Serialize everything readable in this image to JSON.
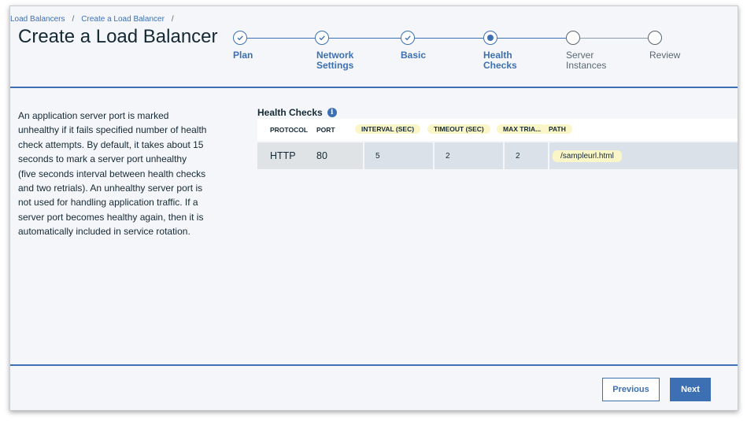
{
  "breadcrumb": {
    "item1": "Load Balancers",
    "item2": "Create a Load Balancer",
    "sep": "/"
  },
  "page_title": "Create a Load Balancer",
  "stepper": {
    "steps": [
      {
        "label": "Plan",
        "state": "complete"
      },
      {
        "label": "Network\nSettings",
        "state": "complete"
      },
      {
        "label": "Basic",
        "state": "complete"
      },
      {
        "label": "Health\nChecks",
        "state": "current"
      },
      {
        "label": "Server\nInstances",
        "state": "pending"
      },
      {
        "label": "Review",
        "state": "pending"
      }
    ]
  },
  "description": "An application server port is marked unhealthy if it fails specified number of health check attempts. By default, it takes about 15 seconds to mark a server port unhealthy (five seconds interval between health checks and two retrials). An unhealthy server port is not used for handling application traffic. If a server port becomes healthy again, then it is automatically included in service rotation.",
  "health_checks": {
    "title": "Health Checks",
    "info_glyph": "i",
    "columns": [
      "PROTOCOL",
      "PORT",
      "INTERVAL (SEC)",
      "TIMEOUT (SEC)",
      "MAX TRIA...",
      "PATH"
    ],
    "row": {
      "protocol": "HTTP",
      "port": "80",
      "interval": "5",
      "timeout": "2",
      "max_tries": "2",
      "path": "/sampleurl.html"
    }
  },
  "buttons": {
    "previous": "Previous",
    "next": "Next"
  },
  "colors": {
    "accent": "#3d70b2",
    "highlight": "#fbf6c8",
    "background": "#f4f6f9"
  }
}
